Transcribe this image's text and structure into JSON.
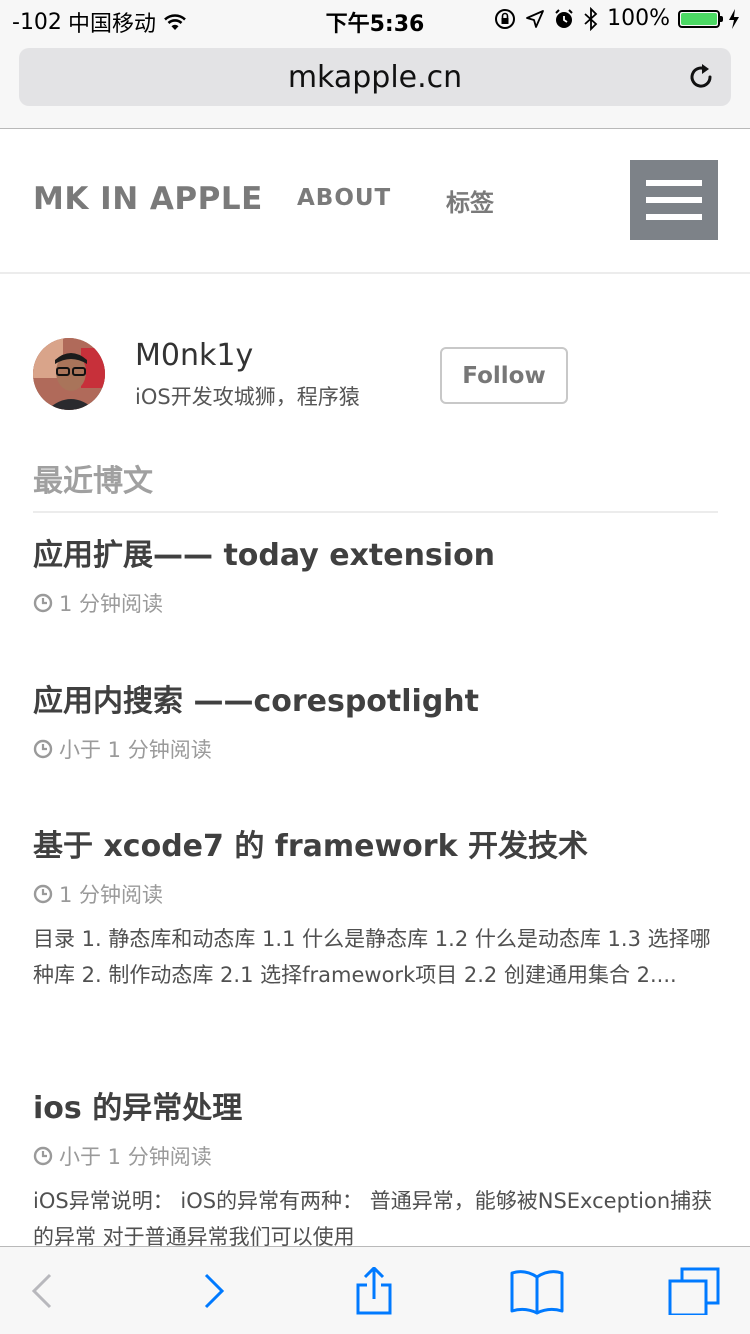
{
  "status_bar": {
    "signal": "-102",
    "carrier": "中国移动",
    "time": "下午5:36",
    "battery": "100%",
    "battery_level": 1.0
  },
  "browser": {
    "url": "mkapple.cn"
  },
  "site": {
    "brand": "MK IN APPLE",
    "nav": {
      "about": "ABOUT",
      "tags": "标签"
    }
  },
  "author": {
    "name": "M0nk1y",
    "bio": "iOS开发攻城狮，程序猿",
    "follow_label": "Follow"
  },
  "section_title": "最近博文",
  "posts": [
    {
      "title": "应用扩展—— today extension",
      "read_time": "1 分钟阅读",
      "excerpt": ""
    },
    {
      "title": "应用内搜索 ——corespotlight",
      "read_time": "小于 1 分钟阅读",
      "excerpt": ""
    },
    {
      "title": "基于 xcode7 的 framework 开发技术",
      "read_time": "1 分钟阅读",
      "excerpt": "目录 1. 静态库和动态库 1.1 什么是静态库 1.2 什么是动态库 1.3 选择哪种库 2. 制作动态库 2.1 选择framework项目 2.2 创建通用集合 2...."
    },
    {
      "title": "ios 的异常处理",
      "read_time": "小于 1 分钟阅读",
      "excerpt": "iOS异常说明： iOS的异常有两种： 普通异常，能够被NSException捕获的异常 对于普通异常我们可以使用"
    }
  ],
  "colors": {
    "accent": "#007aff",
    "menu_button": "#7d8288",
    "battery": "#4cd964"
  },
  "icons": {
    "wifi": "wifi-icon",
    "reload": "reload-icon",
    "clock": "clock-icon",
    "back": "chevron-left-icon",
    "forward": "chevron-right-icon",
    "share": "share-icon",
    "bookmarks": "book-icon",
    "tabs": "tabs-icon"
  }
}
